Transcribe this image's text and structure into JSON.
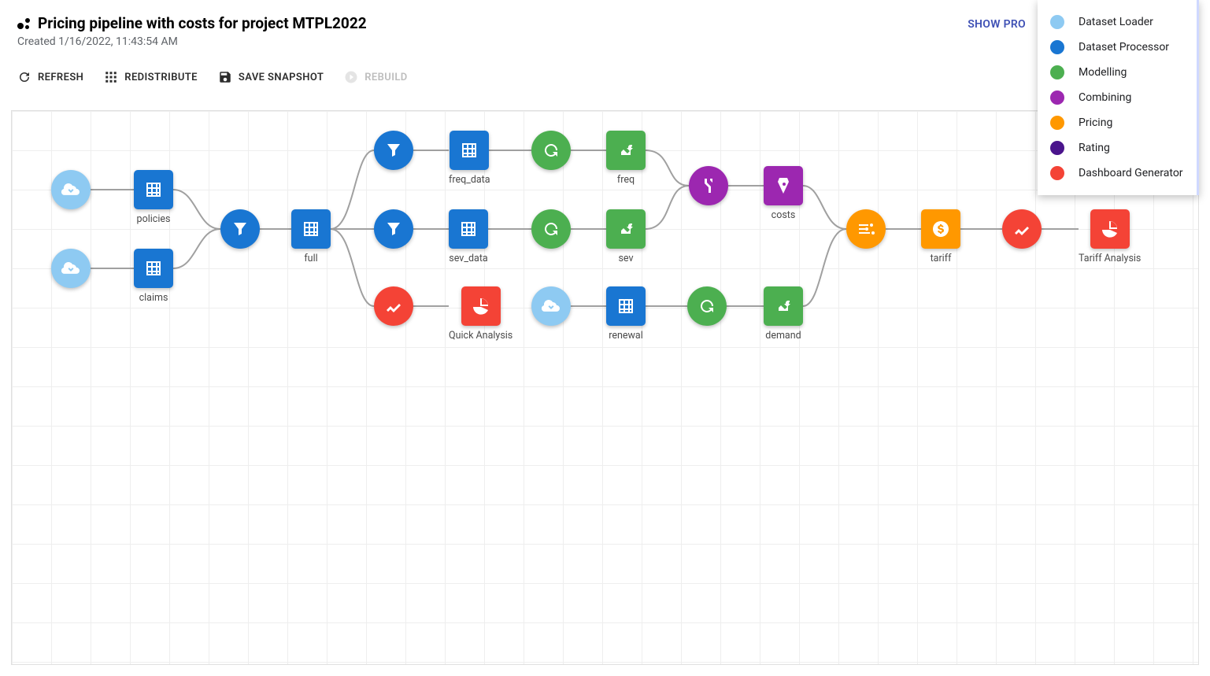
{
  "header": {
    "title": "Pricing pipeline with costs for project MTPL2022",
    "subtitle": "Created 1/16/2022, 11:43:54 AM",
    "show_processors": "SHOW PRO"
  },
  "toolbar": {
    "refresh": "REFRESH",
    "redistribute": "REDISTRIBUTE",
    "save_snapshot": "SAVE SNAPSHOT",
    "rebuild": "REBUILD"
  },
  "legend": [
    {
      "label": "Dataset Loader",
      "color": "#8ecaf2"
    },
    {
      "label": "Dataset Processor",
      "color": "#1976d2"
    },
    {
      "label": "Modelling",
      "color": "#4caf50"
    },
    {
      "label": "Combining",
      "color": "#9c27b0"
    },
    {
      "label": "Pricing",
      "color": "#ff9800"
    },
    {
      "label": "Rating",
      "color": "#4a148c"
    },
    {
      "label": "Dashboard Generator",
      "color": "#f44336"
    }
  ],
  "nodes": {
    "loader_policies": {
      "label": ""
    },
    "loader_claims": {
      "label": ""
    },
    "policies": {
      "label": "policies"
    },
    "claims": {
      "label": "claims"
    },
    "filter_full": {
      "label": ""
    },
    "full": {
      "label": "full"
    },
    "filter_freq": {
      "label": ""
    },
    "freq_data": {
      "label": "freq_data"
    },
    "autorun_freq": {
      "label": ""
    },
    "freq": {
      "label": "freq"
    },
    "filter_sev": {
      "label": ""
    },
    "sev_data": {
      "label": "sev_data"
    },
    "autorun_sev": {
      "label": ""
    },
    "sev": {
      "label": "sev"
    },
    "quick_chart": {
      "label": ""
    },
    "quick_analysis": {
      "label": "Quick Analysis"
    },
    "loader_renewal": {
      "label": ""
    },
    "renewal": {
      "label": "renewal"
    },
    "autorun_demand": {
      "label": ""
    },
    "demand": {
      "label": "demand"
    },
    "combine": {
      "label": ""
    },
    "costs": {
      "label": "costs"
    },
    "pricing_sliders": {
      "label": ""
    },
    "tariff": {
      "label": "tariff"
    },
    "rating_chart": {
      "label": ""
    },
    "tariff_analysis": {
      "label": "Tariff Analysis"
    }
  }
}
